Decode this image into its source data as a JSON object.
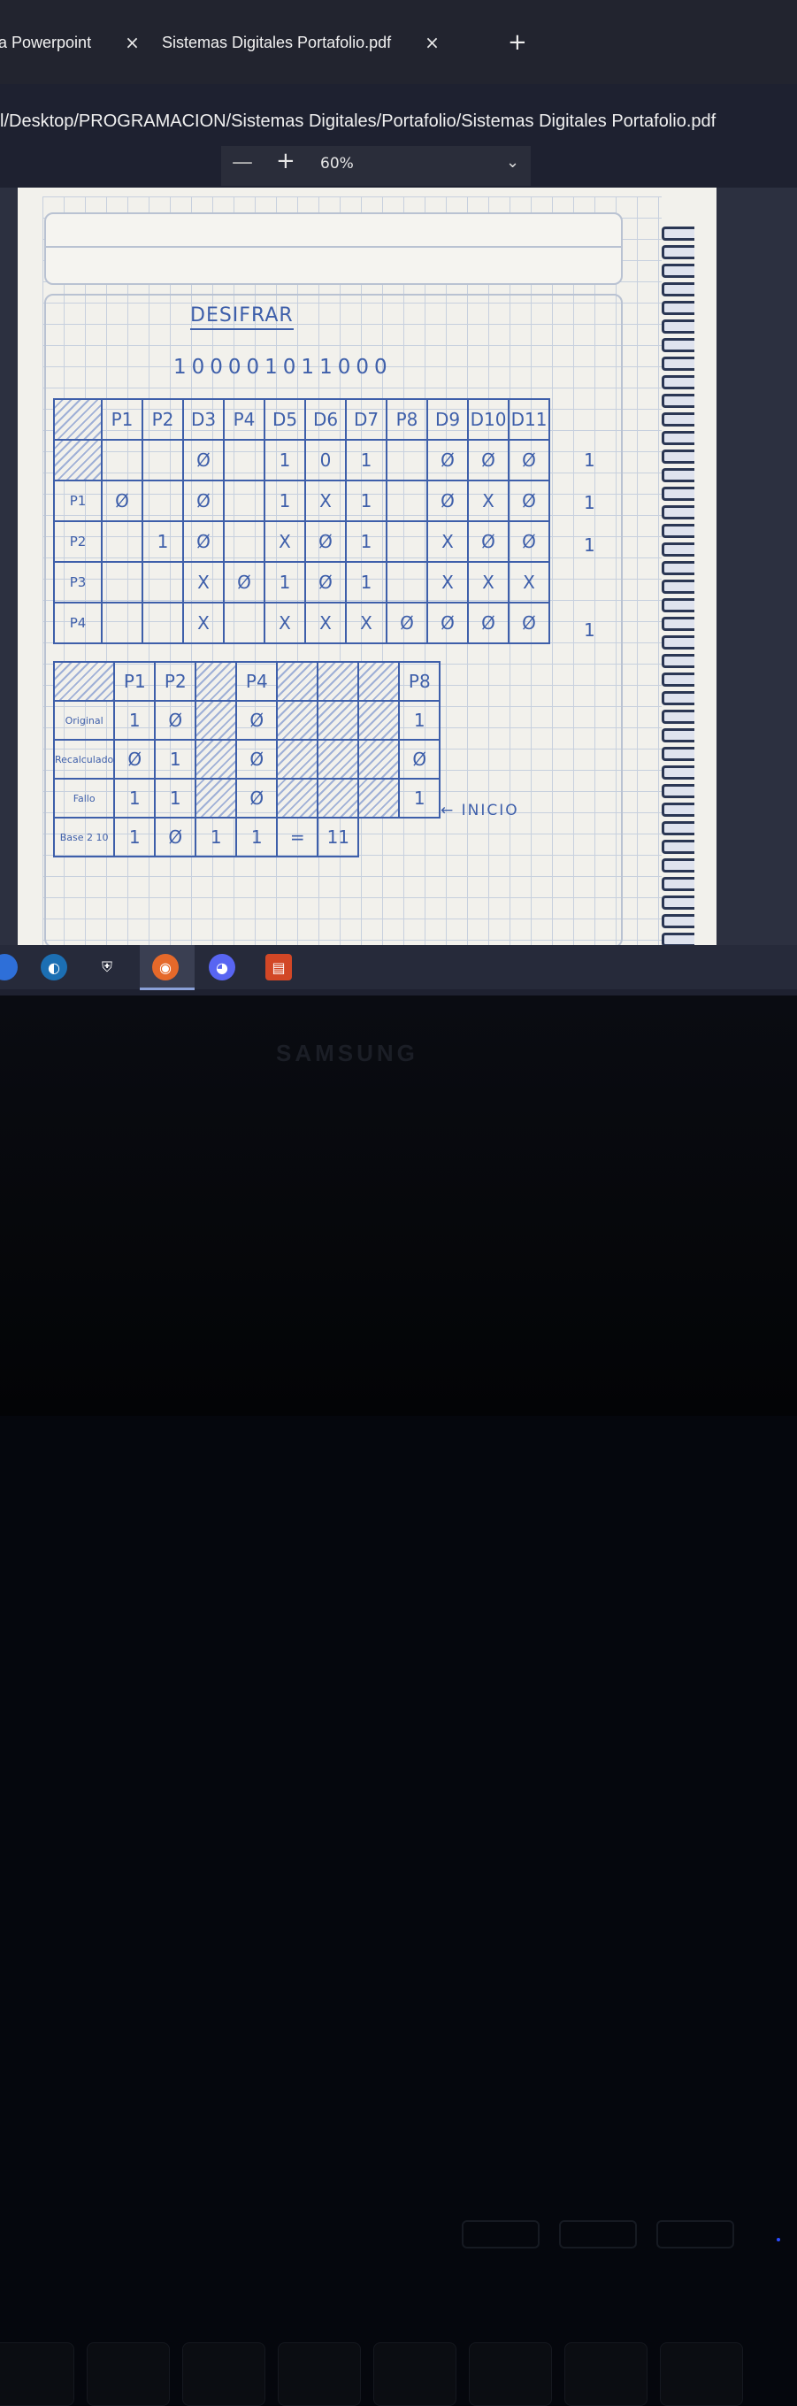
{
  "browser": {
    "tabs": [
      {
        "label": "a Powerpoint"
      },
      {
        "label": "Sistemas Digitales Portafolio.pdf"
      }
    ],
    "close_glyph": "×",
    "new_tab_glyph": "+",
    "address": "l/Desktop/PROGRAMACION/Sistemas Digitales/Portafolio/Sistemas Digitales Portafolio.pdf"
  },
  "pdf_toolbar": {
    "zoom_out": "—",
    "zoom_in": "+",
    "zoom": "60%",
    "chevron": "⌄"
  },
  "sheet": {
    "title": "DESIFRAR",
    "bits": "100001011000",
    "hamming_header": [
      "P1",
      "P2",
      "D3",
      "P4",
      "D5",
      "D6",
      "D7",
      "P8",
      "D9",
      "D10",
      "D11"
    ],
    "hamming_rows": [
      {
        "label": "",
        "cells": [
          "",
          "",
          "Ø",
          "",
          "1",
          "0",
          "1",
          "",
          "Ø",
          "Ø",
          "Ø"
        ],
        "out": "1"
      },
      {
        "label": "P1",
        "cells": [
          "Ø",
          "",
          "Ø",
          "",
          "1",
          "X",
          "1",
          "",
          "Ø",
          "X",
          "Ø"
        ],
        "out": "1"
      },
      {
        "label": "P2",
        "cells": [
          "",
          "1",
          "Ø",
          "",
          "X",
          "Ø",
          "1",
          "",
          "X",
          "Ø",
          "Ø"
        ],
        "out": "1"
      },
      {
        "label": "P3",
        "cells": [
          "",
          "",
          "X",
          "Ø",
          "1",
          "Ø",
          "1",
          "",
          "X",
          "X",
          "X"
        ],
        "out": ""
      },
      {
        "label": "P4",
        "cells": [
          "",
          "",
          "X",
          "",
          "X",
          "X",
          "X",
          "Ø",
          "Ø",
          "Ø",
          "Ø"
        ],
        "out": "1"
      }
    ],
    "parity_header": [
      "P1",
      "P2",
      "",
      "P4",
      "",
      "",
      "",
      "P8"
    ],
    "parity_rows": [
      {
        "label": "Original",
        "cells": [
          "1",
          "Ø",
          "",
          "Ø",
          "",
          "",
          "",
          "1"
        ]
      },
      {
        "label": "Recalculado",
        "cells": [
          "Ø",
          "1",
          "",
          "Ø",
          "",
          "",
          "",
          "Ø"
        ]
      },
      {
        "label": "Fallo",
        "cells": [
          "1",
          "1",
          "",
          "Ø",
          "",
          "",
          "",
          "1"
        ]
      },
      {
        "label": "Base 2 10",
        "cells": [
          "1",
          "Ø",
          "1",
          "1",
          "=",
          "11",
          "",
          ""
        ]
      }
    ],
    "inicio": "← INICIO"
  },
  "bezel": {
    "brand": "SAMSUNG"
  },
  "colors": {
    "ink": "#3e5faa",
    "grid": "#c7d0de",
    "paper": "#f2f1ec",
    "chrome": "#22242f"
  }
}
